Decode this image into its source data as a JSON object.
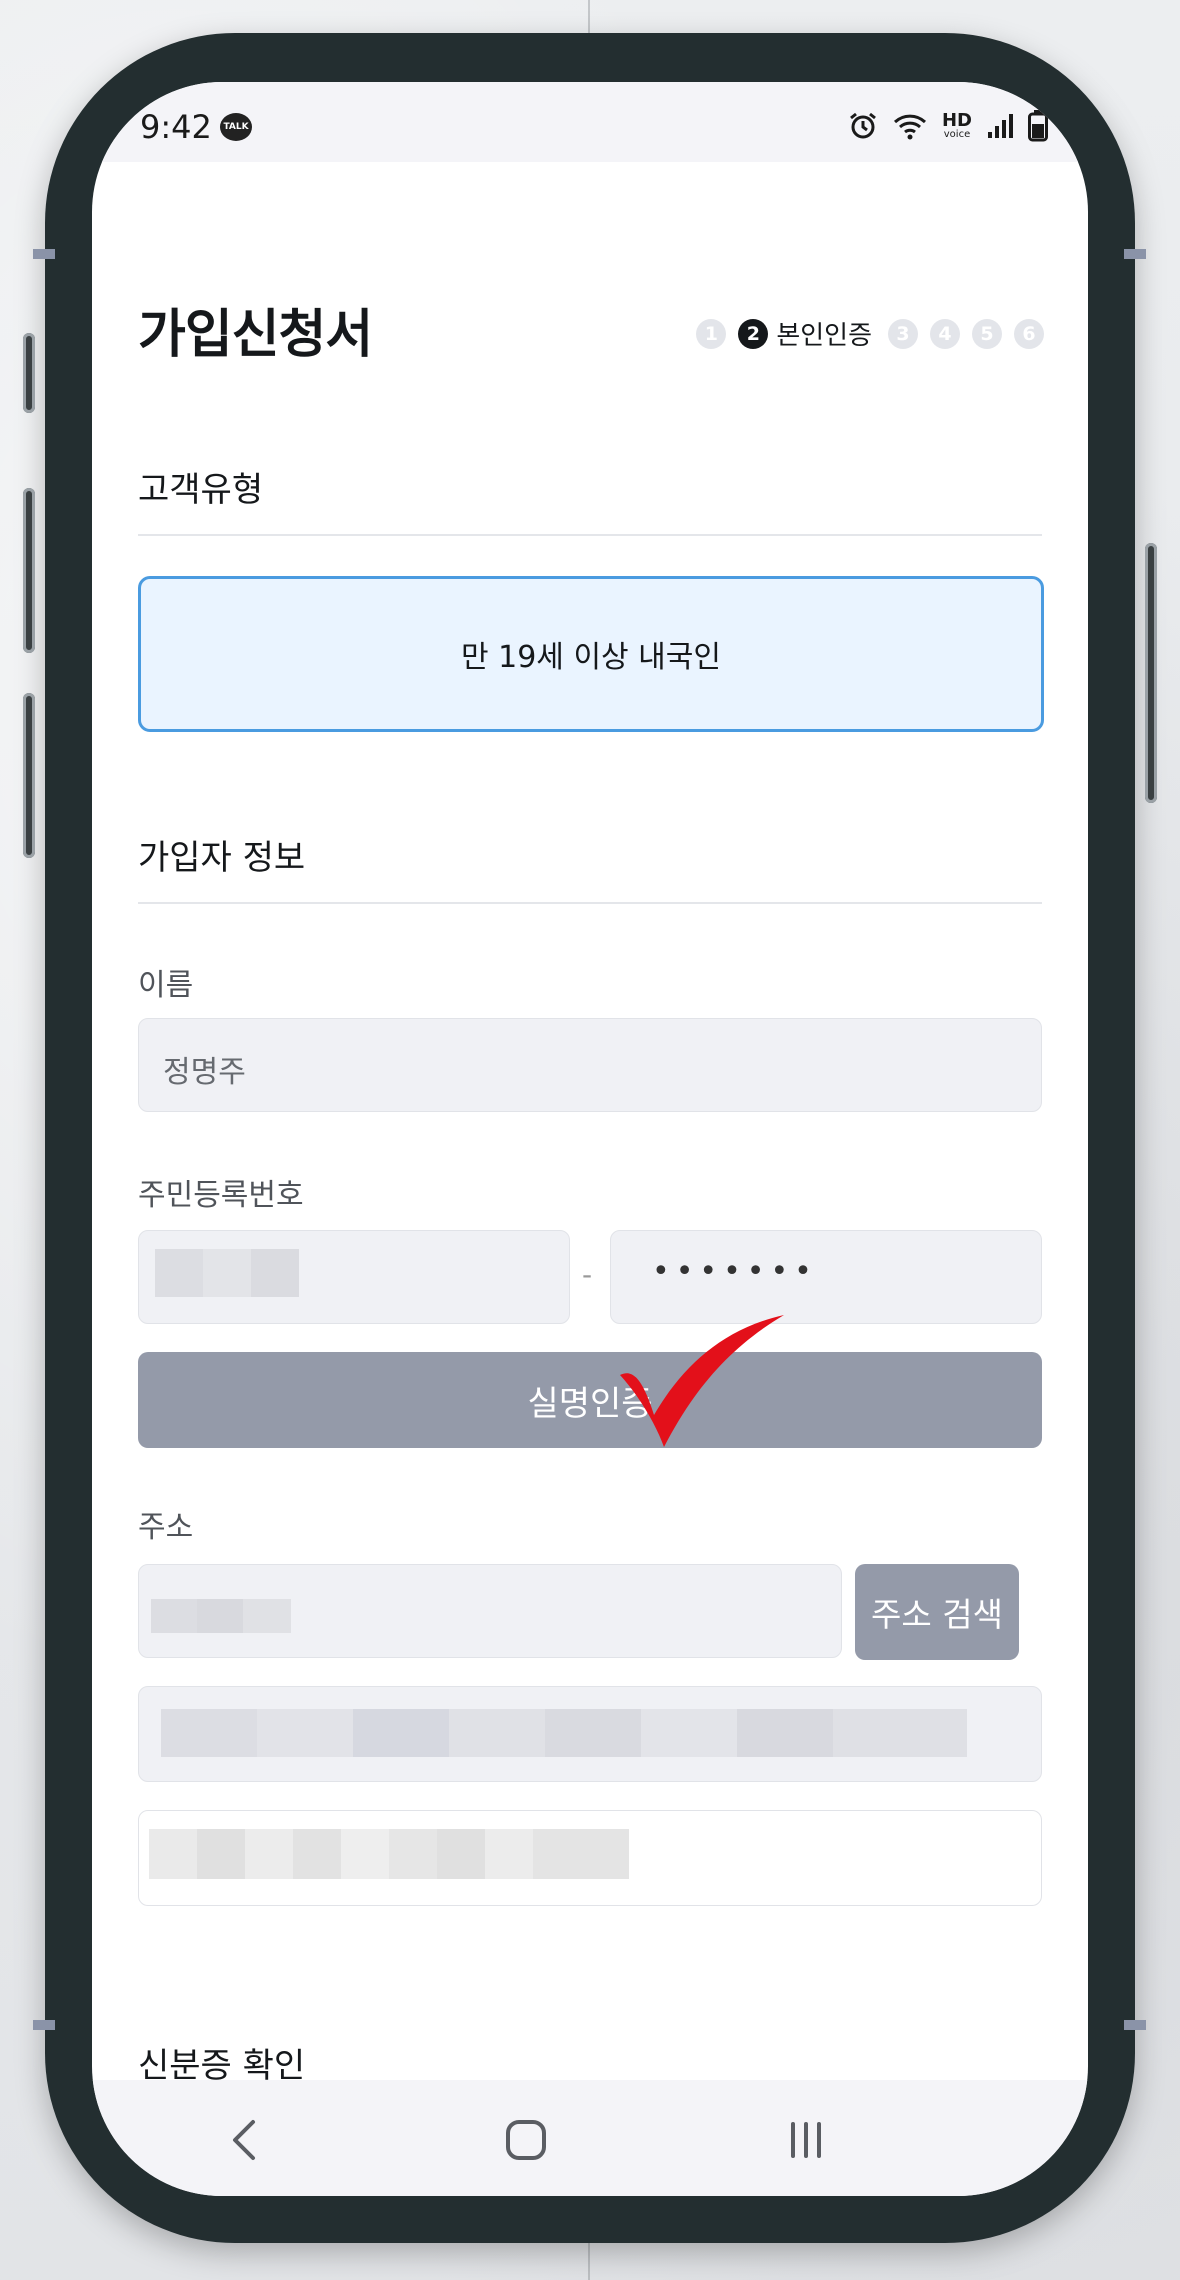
{
  "status_bar": {
    "time": "9:42",
    "talk_label": "TALK",
    "hd_label": "HD",
    "voice_label": "voice"
  },
  "header": {
    "title": "가입신청서"
  },
  "steps": {
    "items": [
      "1",
      "2",
      "3",
      "4",
      "5",
      "6"
    ],
    "active_label": "본인인증"
  },
  "customer_type": {
    "section_title": "고객유형",
    "selected_option": "만 19세 이상 내국인"
  },
  "subscriber_info": {
    "section_title": "가입자 정보",
    "name_label": "이름",
    "name_value": "정명주",
    "rrn_label": "주민등록번호",
    "rrn_separator": "-",
    "rrn_back_masked": "•••••••",
    "verify_button": "실명인증",
    "address_label": "주소",
    "address_search_button": "주소 검색"
  },
  "id_check": {
    "section_title": "신분증 확인"
  },
  "colors": {
    "accent_blue": "#4a9be0",
    "selected_bg": "#eaf4ff",
    "button_gray": "#949aa9",
    "input_bg": "#f0f1f5",
    "checkmark_red": "#e3101a"
  },
  "icons": [
    "talk-icon",
    "alarm-icon",
    "wifi-icon",
    "signal-icon",
    "battery-icon",
    "back-icon",
    "home-icon",
    "recents-icon",
    "checkmark-icon"
  ]
}
